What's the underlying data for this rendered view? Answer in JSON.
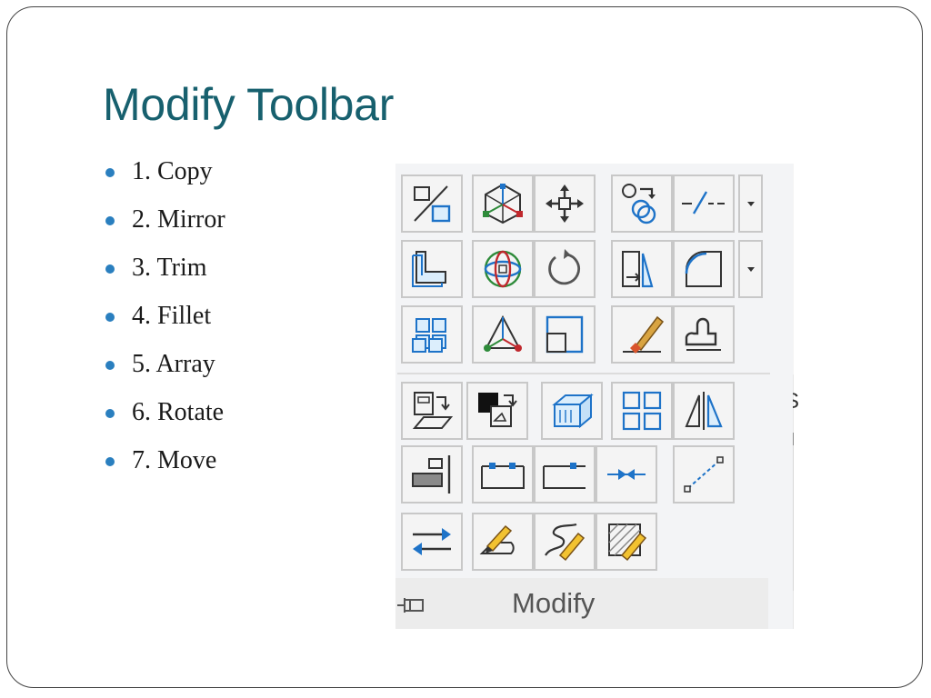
{
  "slide": {
    "title": "Modify Toolbar",
    "bullets": [
      "1. Copy",
      "2. Mirror",
      "3. Trim",
      "4. Fillet",
      "5. Array",
      "6. Rotate",
      "7. Move"
    ]
  },
  "toolbar": {
    "panel_label": "Modify",
    "side_strip_letter": "S",
    "tools": [
      "copy-icon",
      "3d-move-icon",
      "move-icon",
      "scale-icon",
      "break-icon",
      "stretch-icon",
      "3d-rotate-icon",
      "rotate-icon",
      "trim-icon",
      "fillet-icon",
      "array-icon",
      "3d-align-icon",
      "offset-icon",
      "erase-icon",
      "pedit-icon",
      "match-properties-icon",
      "draw-order-icon",
      "solid-edit-icon",
      "rectangular-array-icon",
      "mirror-icon",
      "align-icon",
      "join-icon",
      "lengthen-icon",
      "break-at-point-icon",
      "explode-icon",
      "swap-icon",
      "edit-polyline-icon",
      "edit-spline-icon",
      "edit-hatch-icon"
    ]
  },
  "colors": {
    "title": "#17606e",
    "bullet": "#2a7fbf",
    "icon_blue": "#1e73c8"
  }
}
